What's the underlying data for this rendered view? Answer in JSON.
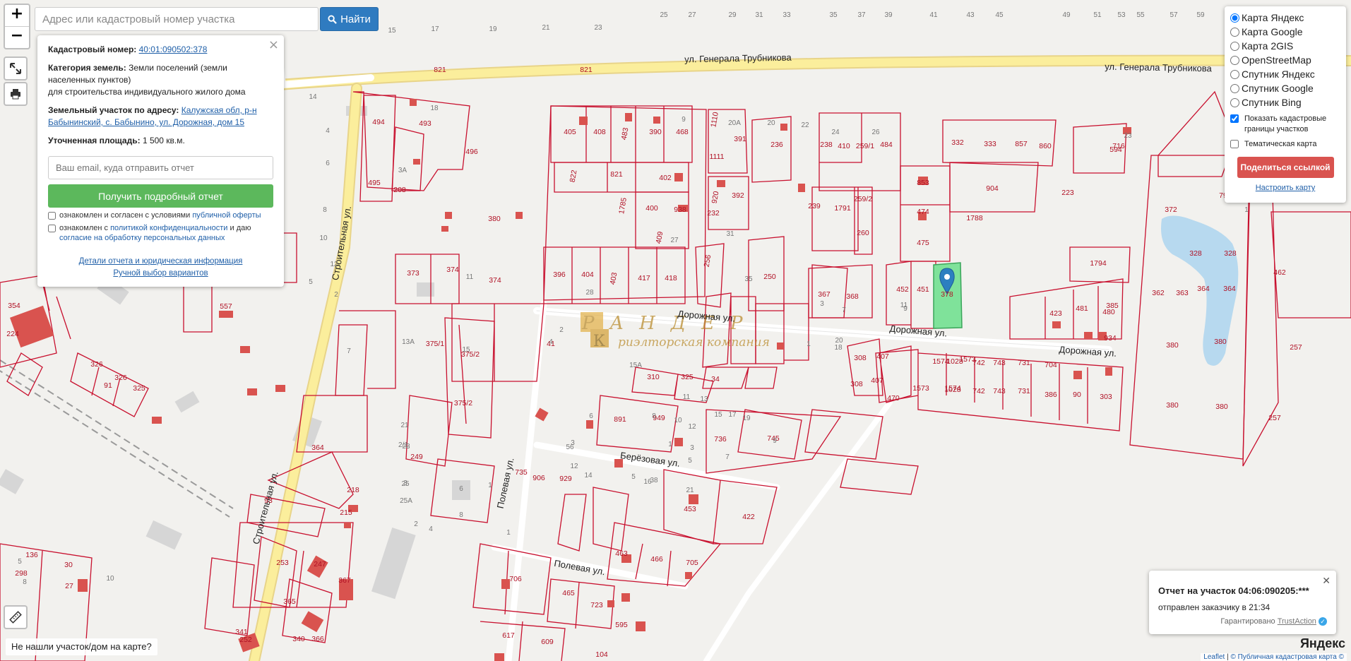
{
  "search": {
    "placeholder": "Адрес или кадастровый номер участка",
    "button_label": "Найти"
  },
  "parcel": {
    "cadastral_label": "Кадастровый номер:",
    "cadastral_value": "40:01:090502:378",
    "category_label": "Категория земель:",
    "category_value": "Земли поселений (земли населенных пунктов)",
    "usage": "для строительства индивидуального жилого дома",
    "address_label": "Земельный участок по адресу:",
    "address_value": "Калужская обл, р-н Бабынинский, с. Бабынино, ул. Дорожная, дом 15",
    "area_label": "Уточненная площадь:",
    "area_value": "1 500 кв.м.",
    "email_placeholder": "Ваш email, куда отправить отчет",
    "report_button": "Получить подробный отчет",
    "consent1_text": "ознакомлен и согласен с условиями",
    "consent1_link": "публичной оферты",
    "consent2_text": "ознакомлен с",
    "consent2_link": "политикой конфиденциальности",
    "consent2_mid": "и даю",
    "consent2_link2": "согласие на обработку персональных данных",
    "details_link": "Детали отчета и юридическая информация",
    "manual_link": "Ручной выбор вариантов"
  },
  "layers": {
    "options": [
      "Карта Яндекс",
      "Карта Google",
      "Карта 2GIS",
      "OpenStreetMap",
      "Спутник Яндекс",
      "Спутник Google",
      "Спутник Bing"
    ],
    "selected": "Карта Яндекс",
    "show_borders": "Показать кадастровые границы участков",
    "thematic": "Тематическая карта",
    "share_button": "Поделиться ссылкой",
    "configure": "Настроить карту"
  },
  "notification": {
    "title": "Отчет на участок 04:06:090205:***",
    "subtitle": "отправлен заказчику в 21:34",
    "guarantee": "Гарантировано",
    "brand": "TrustAction"
  },
  "not_found": "Не нашли участок/дом на карте?",
  "attribution": {
    "leaflet": "Leaflet",
    "sep": "|",
    "pkk": "© Публичная кадастровая карта ©"
  },
  "yandex_logo": "Яндекс",
  "watermark": {
    "letters": "РАНДЕР",
    "subtitle": "риэлторская компания"
  },
  "map": {
    "streets": [
      "ул. Генерала Трубникова",
      "ул. Генерала Трубникова",
      "Дорожная ул.",
      "Дорожная ул.",
      "Дорожная ул.",
      "Строительная ул.",
      "Строительная ул.",
      "Берёзовая ул.",
      "Полевая ул.",
      "Полевая ул."
    ],
    "parcel_numbers": [
      "821",
      "821",
      "493",
      "494",
      "496",
      "495",
      "208",
      "373",
      "374",
      "374",
      "375/1",
      "375/2",
      "375/2",
      "405",
      "408",
      "483",
      "390",
      "468",
      "822",
      "821",
      "402",
      "1785",
      "400",
      "938",
      "409",
      "396",
      "404",
      "403",
      "417",
      "418",
      "1110",
      "391",
      "1111",
      "920",
      "392",
      "232",
      "256",
      "250",
      "236",
      "238",
      "410",
      "259/1",
      "484",
      "239",
      "1791",
      "259/2",
      "260",
      "367",
      "368",
      "853",
      "474",
      "475",
      "1788",
      "452",
      "451",
      "378",
      "332",
      "333",
      "857",
      "860",
      "904",
      "223",
      "594",
      "716",
      "1794",
      "423",
      "481",
      "480",
      "385",
      "934",
      "372",
      "79",
      "328",
      "328",
      "362",
      "363",
      "364",
      "364",
      "380",
      "380",
      "380",
      "380",
      "462",
      "257",
      "257",
      "308",
      "407",
      "308",
      "407",
      "470",
      "1573",
      "1573",
      "1574",
      "1574",
      "1028",
      "1028",
      "742",
      "742",
      "743",
      "743",
      "731",
      "731",
      "704",
      "386",
      "90",
      "303",
      "41",
      "310",
      "325",
      "34",
      "891",
      "949",
      "736",
      "745",
      "735",
      "906",
      "929",
      "453",
      "422",
      "463",
      "466",
      "705",
      "706",
      "465",
      "723",
      "595",
      "617",
      "609",
      "104",
      "249",
      "218",
      "215",
      "93",
      "364",
      "253",
      "247",
      "367",
      "365",
      "366",
      "252",
      "340",
      "341",
      "136",
      "298",
      "30",
      "27",
      "326",
      "326",
      "325",
      "91",
      "224",
      "557",
      "380",
      "354"
    ],
    "house_numbers": [
      "25",
      "27",
      "29",
      "31",
      "33",
      "35",
      "37",
      "39",
      "41",
      "43",
      "45",
      "49",
      "51",
      "53",
      "55",
      "57",
      "59",
      "15",
      "17",
      "19",
      "21",
      "23",
      "18",
      "3А",
      "8",
      "10",
      "14",
      "6",
      "4",
      "2",
      "11",
      "13А",
      "15",
      "15А",
      "12",
      "5",
      "7",
      "9",
      "20А",
      "20",
      "22",
      "24",
      "26",
      "28",
      "27",
      "31",
      "35",
      "3",
      "7",
      "9",
      "11",
      "1",
      "18",
      "20",
      "2",
      "4",
      "6",
      "8",
      "10",
      "12",
      "1",
      "3",
      "5",
      "7",
      "9",
      "11",
      "13",
      "15",
      "17",
      "19",
      "21",
      "23",
      "25",
      "25А",
      "2",
      "4",
      "6",
      "8",
      "1",
      "3",
      "5",
      "38",
      "56",
      "12",
      "14",
      "16",
      "21",
      "23",
      "1",
      "5",
      "8",
      "10",
      "2/1",
      "3",
      "1"
    ]
  }
}
